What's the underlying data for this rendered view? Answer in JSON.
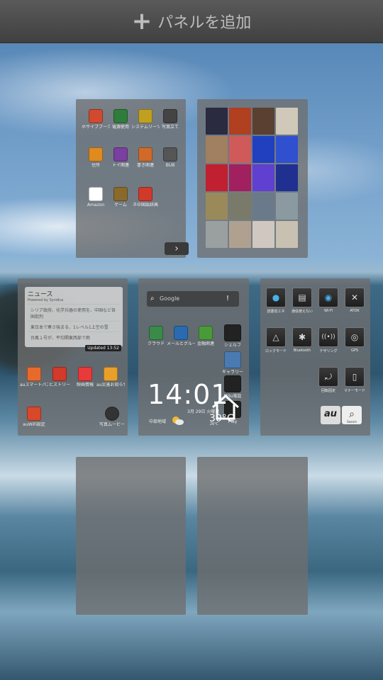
{
  "topbar": {
    "add_panel_label": "パネルを追加"
  },
  "panels": {
    "p1": {
      "apps": [
        {
          "label": "ホサイプブーク",
          "color": "#d04a2f"
        },
        {
          "label": "電源使用",
          "color": "#2f7d3a"
        },
        {
          "label": "システムリーツール",
          "color": "#c0a020"
        },
        {
          "label": "写真立て",
          "color": "#444444"
        },
        {
          "label": "住所",
          "color": "#e08a20"
        },
        {
          "label": "トイ関連",
          "color": "#7a3fa0"
        },
        {
          "label": "書き関連",
          "color": "#d06a2a"
        },
        {
          "label": "BUB",
          "color": "#555555"
        },
        {
          "label": "Amazon",
          "color": "#ffffff"
        },
        {
          "label": "ゲーム",
          "color": "#8a6a2a"
        },
        {
          "label": "ネ中国語辞典",
          "color": "#d03a2a"
        }
      ]
    },
    "p2": {
      "next_icon": "chevron-right-icon",
      "next_symbol": "›"
    },
    "p3": {
      "news_title": "ニュース",
      "news_sub": "Powered by Syndica",
      "news_lines": [
        "シリア政府、化学兵器の使用を、中国など各国批判",
        "東日本で寒さ強まる、1レベル1上空の雪",
        "台風１号が、平均関東西部で雨"
      ],
      "updated": "Updated 13:52",
      "apps": [
        {
          "label": "auスマートパス",
          "color": "#e86a2a"
        },
        {
          "label": "ヒストリー",
          "color": "#d23a2a"
        },
        {
          "label": "映画情報",
          "color": "#e83a3a"
        },
        {
          "label": "au災害お知らせ",
          "color": "#e8a02a"
        },
        {
          "label": "auWiFi設定",
          "color": "#d8482a"
        },
        {
          "label": "写真ムービー",
          "color": "#333333"
        }
      ]
    },
    "p4": {
      "search_placeholder": "Google",
      "apps": [
        {
          "label": "クラウド",
          "color": "#3a8a4a"
        },
        {
          "label": "メールとグループ",
          "color": "#2a6ab0"
        },
        {
          "label": "金融関連",
          "color": "#4a9a3a"
        }
      ],
      "side_apps": [
        "シェルフ",
        "ギャラリー",
        "Mitu電話",
        "Play"
      ],
      "clock": "14:01",
      "date": "3月 29日 火曜日",
      "location": "中部地域",
      "temp": "30°C",
      "temp_range": "26℃",
      "home_icon": "home-icon"
    },
    "p5": {
      "toggles": [
        {
          "label": "読書省エネ",
          "symbol": "●",
          "icon": "globe-icon"
        },
        {
          "label": "通信使えない",
          "symbol": "▤",
          "icon": "signal-icon"
        },
        {
          "label": "Wi-Fi",
          "symbol": "◉",
          "icon": "wifi-icon"
        },
        {
          "label": "ATOK",
          "symbol": "✕",
          "icon": "keyboard-icon"
        },
        {
          "label": "ロックモード",
          "symbol": "△",
          "icon": "triangle-icon"
        },
        {
          "label": "Bluetooth",
          "symbol": "✱",
          "icon": "bluetooth-icon"
        },
        {
          "label": "テザリング",
          "symbol": "((•))",
          "icon": "tethering-icon"
        },
        {
          "label": "GPS",
          "symbol": "◎",
          "icon": "gps-icon"
        },
        {
          "label": "回転固定",
          "symbol": "⤾",
          "icon": "rotate-icon"
        },
        {
          "label": "マナーモード",
          "symbol": "▯",
          "icon": "vibrate-icon"
        }
      ],
      "au_label": "au",
      "search_label": "Search"
    }
  }
}
